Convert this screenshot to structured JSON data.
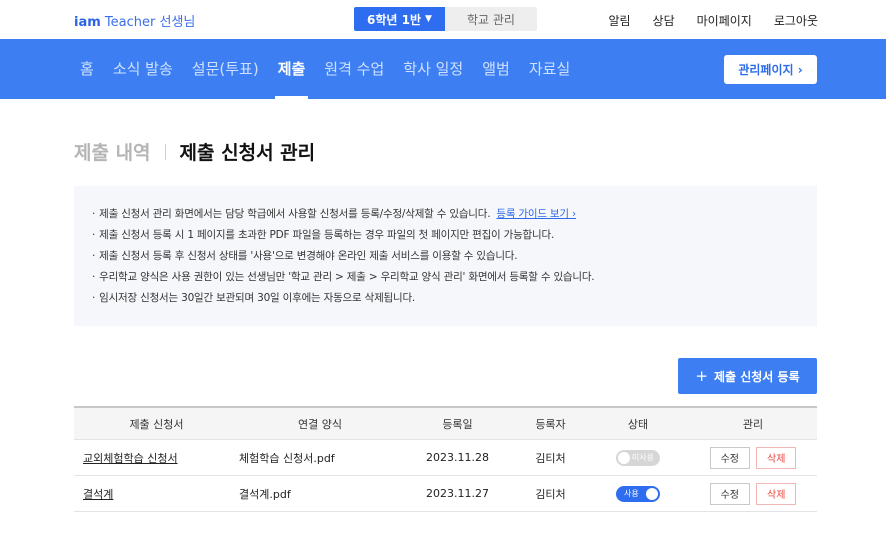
{
  "header": {
    "logo_brand": "iam",
    "logo_rest": "Teacher 선생님",
    "class_selector": "6학년 1반",
    "school_manage": "학교 관리",
    "links": [
      "알림",
      "상담",
      "마이페이지",
      "로그아웃"
    ]
  },
  "nav": {
    "items": [
      "홈",
      "소식 발송",
      "설문(투표)",
      "제출",
      "원격 수업",
      "학사 일정",
      "앨범",
      "자료실"
    ],
    "active": "제출",
    "admin_button": "관리페이지 ›"
  },
  "page": {
    "breadcrumb_muted": "제출 내역",
    "title": "제출 신청서 관리"
  },
  "notice": {
    "lines": [
      "제출 신청서 관리 화면에서는 담당 학급에서 사용할 신청서를 등록/수정/삭제할 수 있습니다.",
      "제출 신청서 등록 시 1 페이지를 초과한 PDF 파일을 등록하는 경우 파일의 첫 페이지만 편집이 가능합니다.",
      "제출 신청서 등록 후 신청서 상태를 '사용'으로 변경해야 온라인 제출 서비스를 이용할 수 있습니다.",
      "우리학교 양식은 사용 권한이 있는 선생님만 '학교 관리 > 제출 > 우리학교 양식 관리' 화면에서 등록할 수 있습니다.",
      "임시저장 신청서는 30일간 보관되며 30일 이후에는 자동으로 삭제됩니다."
    ],
    "guide_link": "등록 가이드 보기 ›"
  },
  "register_button": "제출 신청서 등록",
  "table": {
    "headers": [
      "제출 신청서",
      "연결 양식",
      "등록일",
      "등록자",
      "상태",
      "관리"
    ],
    "rows": [
      {
        "name": "교외체험학습 신청서",
        "file": "체험학습 신청서.pdf",
        "date": "2023.11.28",
        "author": "김티처",
        "status": "미사용",
        "status_on": false,
        "edit": "수정",
        "delete": "삭제"
      },
      {
        "name": "결석계",
        "file": "결석계.pdf",
        "date": "2023.11.27",
        "author": "김티처",
        "status": "사용",
        "status_on": true,
        "edit": "수정",
        "delete": "삭제"
      }
    ]
  },
  "colors": {
    "primary": "#3d7ff2",
    "nav_band": "#3d7ff2",
    "delete_red": "#e8463f"
  }
}
